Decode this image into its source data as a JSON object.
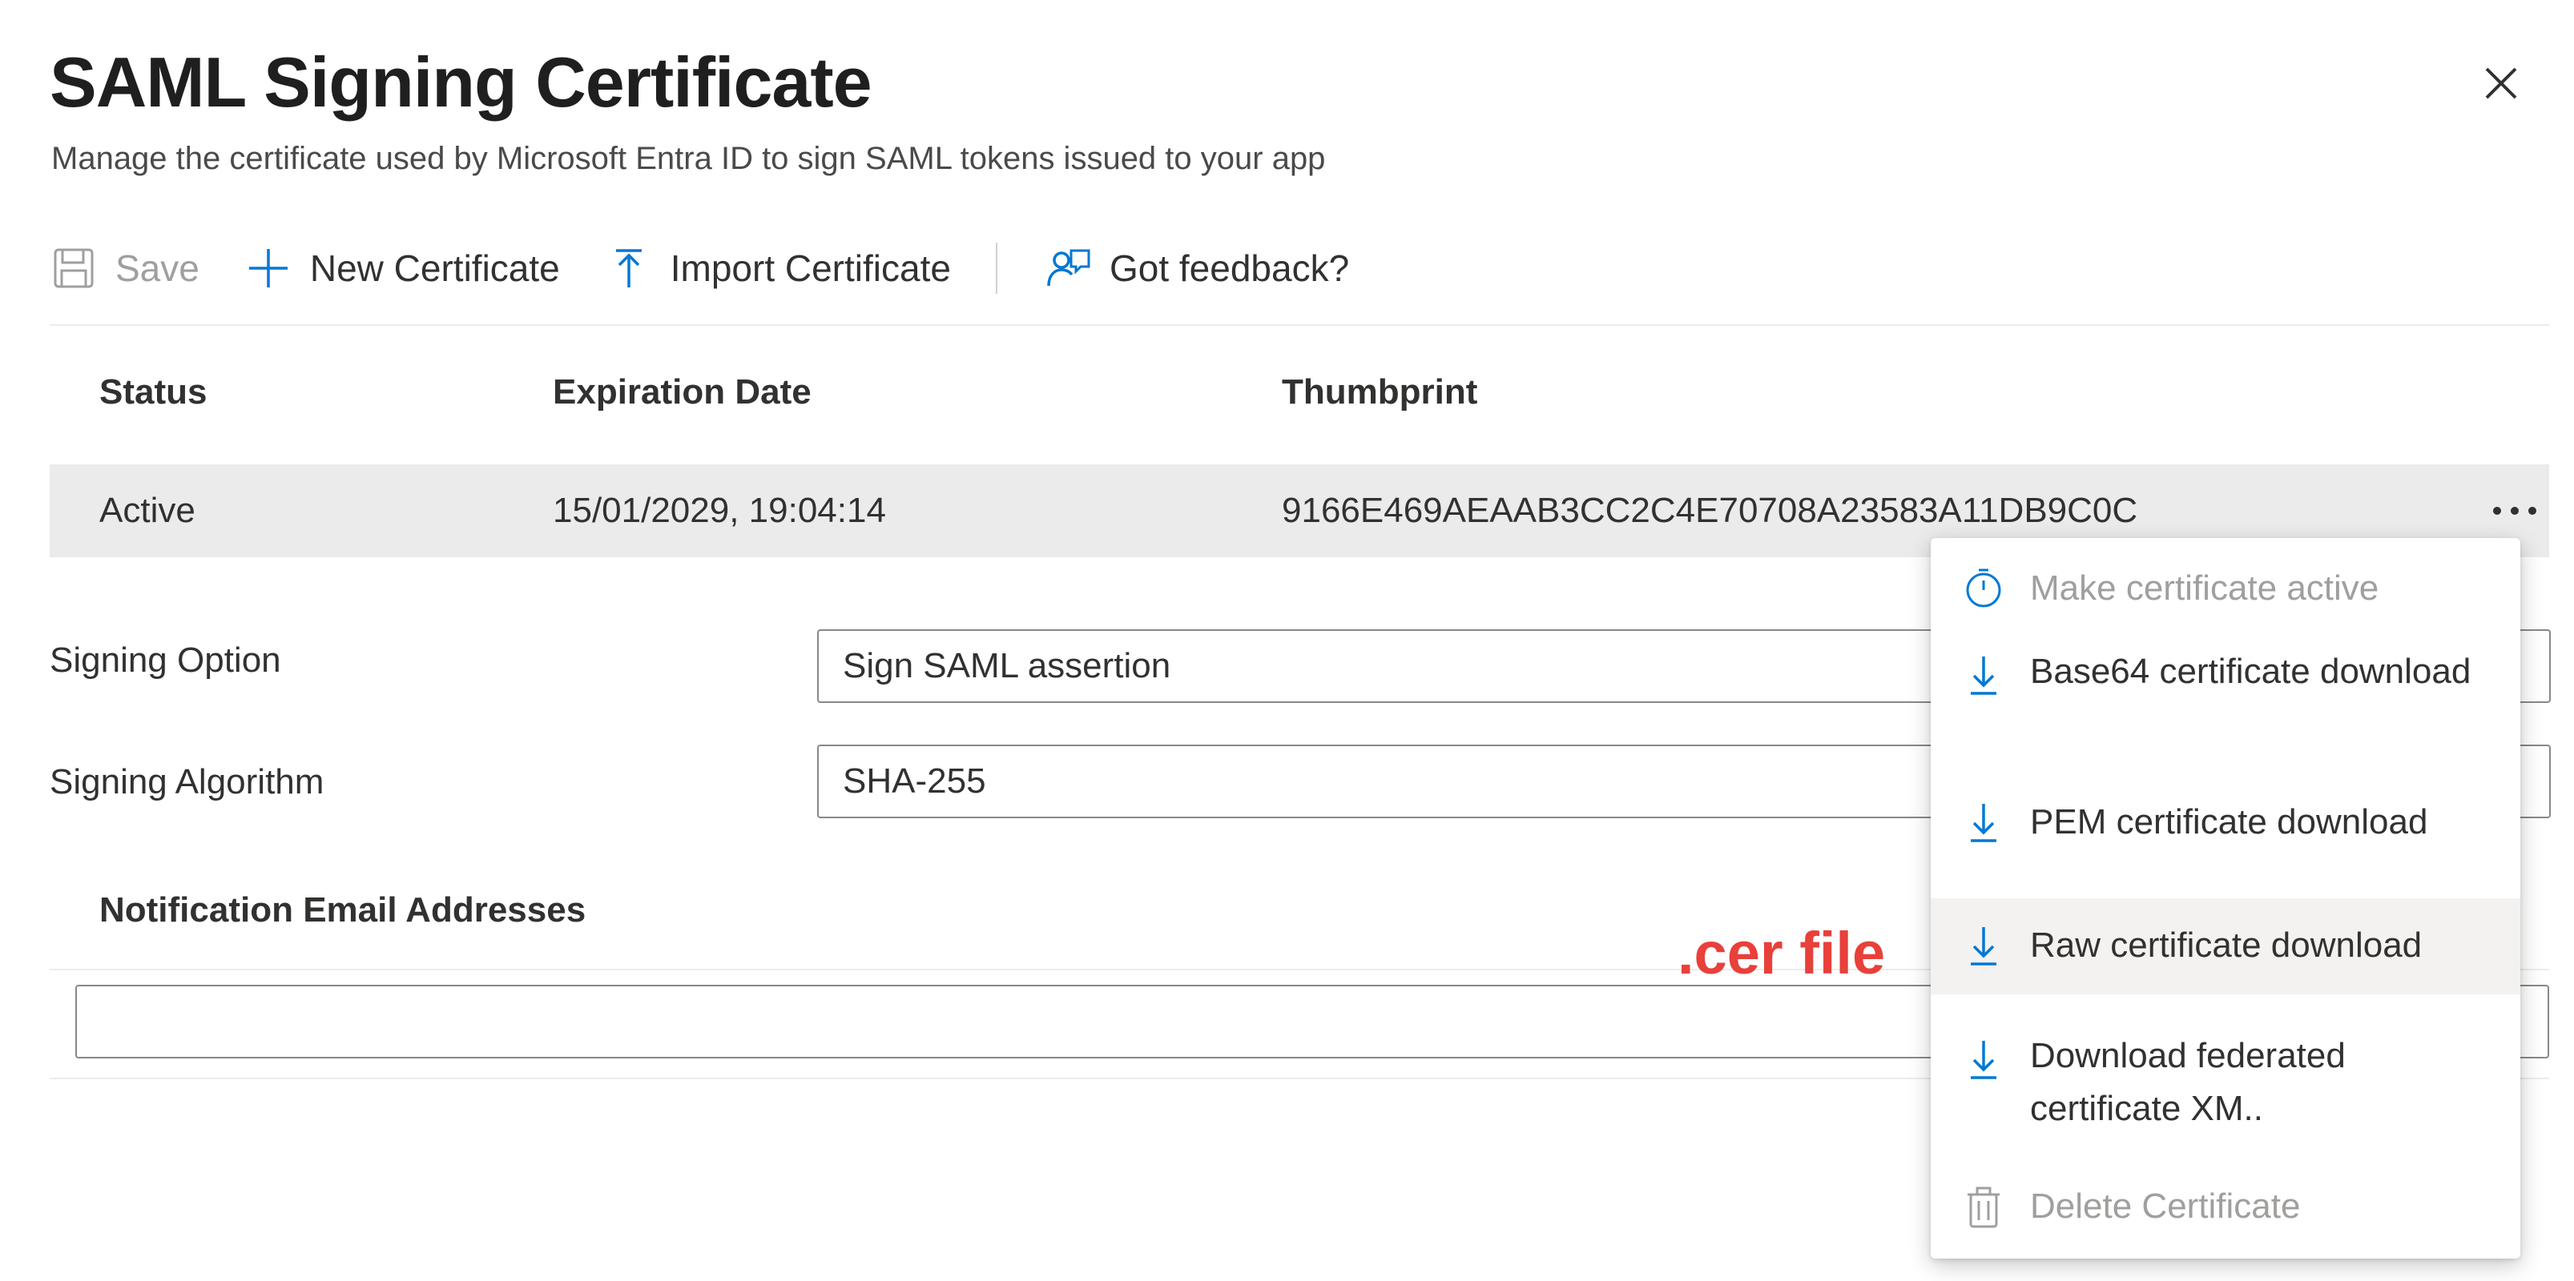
{
  "header": {
    "title": "SAML Signing Certificate",
    "subtitle": "Manage the certificate used by Microsoft Entra ID to sign SAML tokens issued to your app"
  },
  "toolbar": {
    "save_label": "Save",
    "new_certificate_label": "New Certificate",
    "import_certificate_label": "Import Certificate",
    "feedback_label": "Got feedback?"
  },
  "certificates_table": {
    "columns": [
      "Status",
      "Expiration Date",
      "Thumbprint"
    ],
    "rows": [
      {
        "status": "Active",
        "expiration": "15/01/2029, 19:04:14",
        "thumbprint": "9166E469AEAAB3CC2C4E70708A23583A11DB9C0C"
      }
    ]
  },
  "form": {
    "signing_option_label": "Signing Option",
    "signing_option_value": "Sign SAML assertion",
    "signing_algorithm_label": "Signing Algorithm",
    "signing_algorithm_value": "SHA-255"
  },
  "notification": {
    "header": "Notification Email Addresses",
    "input_value": ""
  },
  "annotation": ".cer file",
  "context_menu": {
    "items": [
      {
        "label": "Make certificate active",
        "icon": "timer-icon",
        "disabled": true
      },
      {
        "label": "Base64 certificate download",
        "icon": "download-icon",
        "disabled": false
      },
      {
        "label": "PEM certificate download",
        "icon": "download-icon",
        "disabled": false
      },
      {
        "label": "Raw certificate download",
        "icon": "download-icon",
        "disabled": false,
        "highlighted": true
      },
      {
        "label": "Download federated certificate XM..",
        "icon": "download-icon",
        "disabled": false
      },
      {
        "label": "Delete Certificate",
        "icon": "trash-icon",
        "disabled": true
      }
    ]
  },
  "colors": {
    "accent": "#0078d4",
    "annotation": "#e8403a",
    "row_highlight": "#ebebeb",
    "disabled_text": "#a19f9d"
  }
}
